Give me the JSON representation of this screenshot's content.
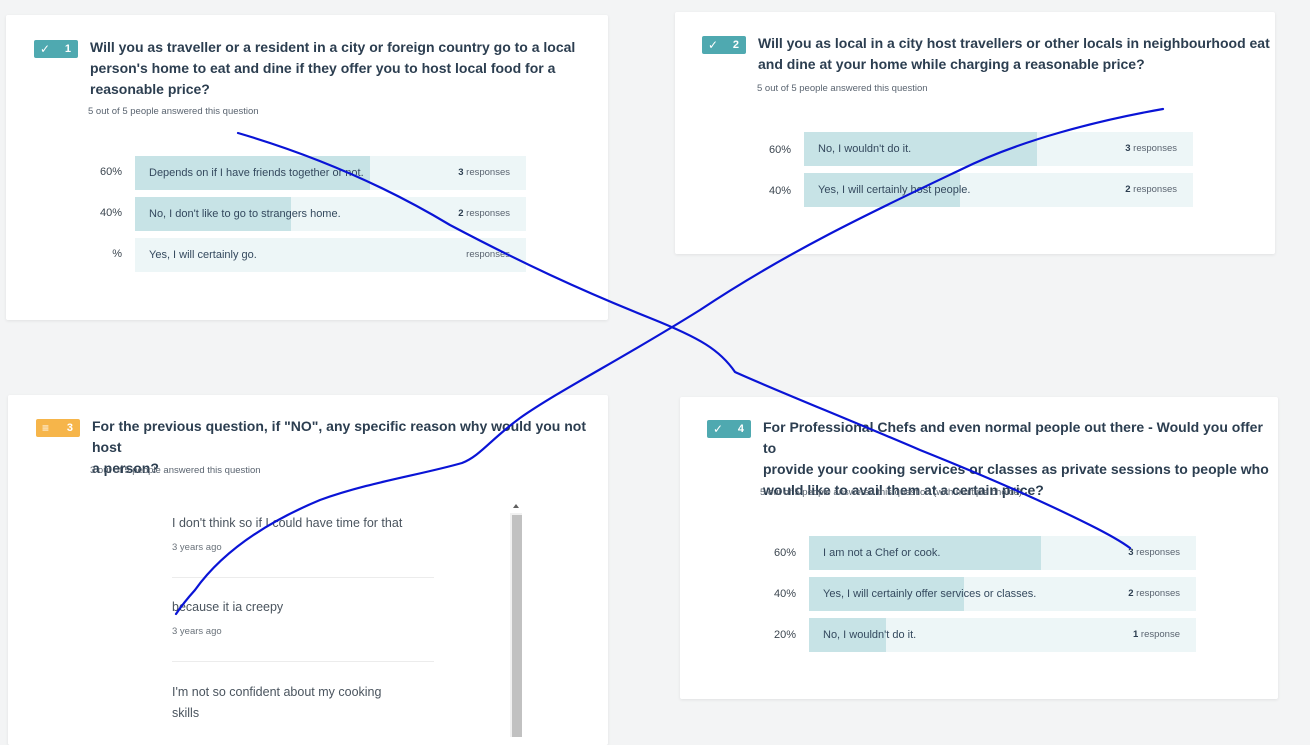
{
  "questions": [
    {
      "number": "1",
      "badge_icon": "✓",
      "title_lines": [
        "Will you as traveller or a resident in a city or foreign country go to a local",
        "person's home to eat and dine if they offer you to host local food for a",
        "reasonable price?"
      ],
      "answered": "5 out of 5 people answered this question",
      "options": [
        {
          "pct": "60%",
          "label": "Depends on if I have friends together or not.",
          "count": "3",
          "unit": "responses",
          "fill": 0.6
        },
        {
          "pct": "40%",
          "label": "No, I don't like to go to strangers home.",
          "count": "2",
          "unit": "responses",
          "fill": 0.4
        },
        {
          "pct": "%",
          "label": "Yes, I will certainly go.",
          "count": "",
          "unit": "responses",
          "fill": 0
        }
      ]
    },
    {
      "number": "2",
      "badge_icon": "✓",
      "title_lines": [
        "Will you as local in a city host travellers or other locals in neighbourhood eat",
        "and dine at your home while charging a reasonable price?"
      ],
      "answered": "5 out of 5 people answered this question",
      "options": [
        {
          "pct": "60%",
          "label": "No, I wouldn't do it.",
          "count": "3",
          "unit": "responses",
          "fill": 0.6
        },
        {
          "pct": "40%",
          "label": "Yes, I will certainly host people.",
          "count": "2",
          "unit": "responses",
          "fill": 0.4
        }
      ]
    },
    {
      "number": "3",
      "badge_icon": "≡",
      "title_lines": [
        "For the previous question, if \"NO\", any specific reason why would you not host",
        "a person?"
      ],
      "answered": "3 out of 5 people answered this question",
      "entries": [
        {
          "lines": [
            "I don't think so if I could have time for that"
          ],
          "time": "3 years ago"
        },
        {
          "lines": [
            "because it ia creepy"
          ],
          "time": "3 years ago"
        },
        {
          "lines": [
            "I'm not so confident about my cooking",
            "skills"
          ],
          "time": ""
        }
      ]
    },
    {
      "number": "4",
      "badge_icon": "✓",
      "title_lines": [
        "For Professional Chefs and even normal people out there - Would you offer to",
        "provide your cooking services or classes as private sessions to people who",
        "would like to avail them at a certain price?"
      ],
      "answered": "5 out of 5 people answered this question (with multiple choice)",
      "options": [
        {
          "pct": "60%",
          "label": "I am not a Chef or cook.",
          "count": "3",
          "unit": "responses",
          "fill": 0.6
        },
        {
          "pct": "40%",
          "label": "Yes, I will certainly offer services or classes.",
          "count": "2",
          "unit": "responses",
          "fill": 0.4
        },
        {
          "pct": "20%",
          "label": "No, I wouldn't do it.",
          "count": "1",
          "unit": "response",
          "fill": 0.2
        }
      ]
    }
  ],
  "annotation": {
    "color": "#0a14d6"
  }
}
